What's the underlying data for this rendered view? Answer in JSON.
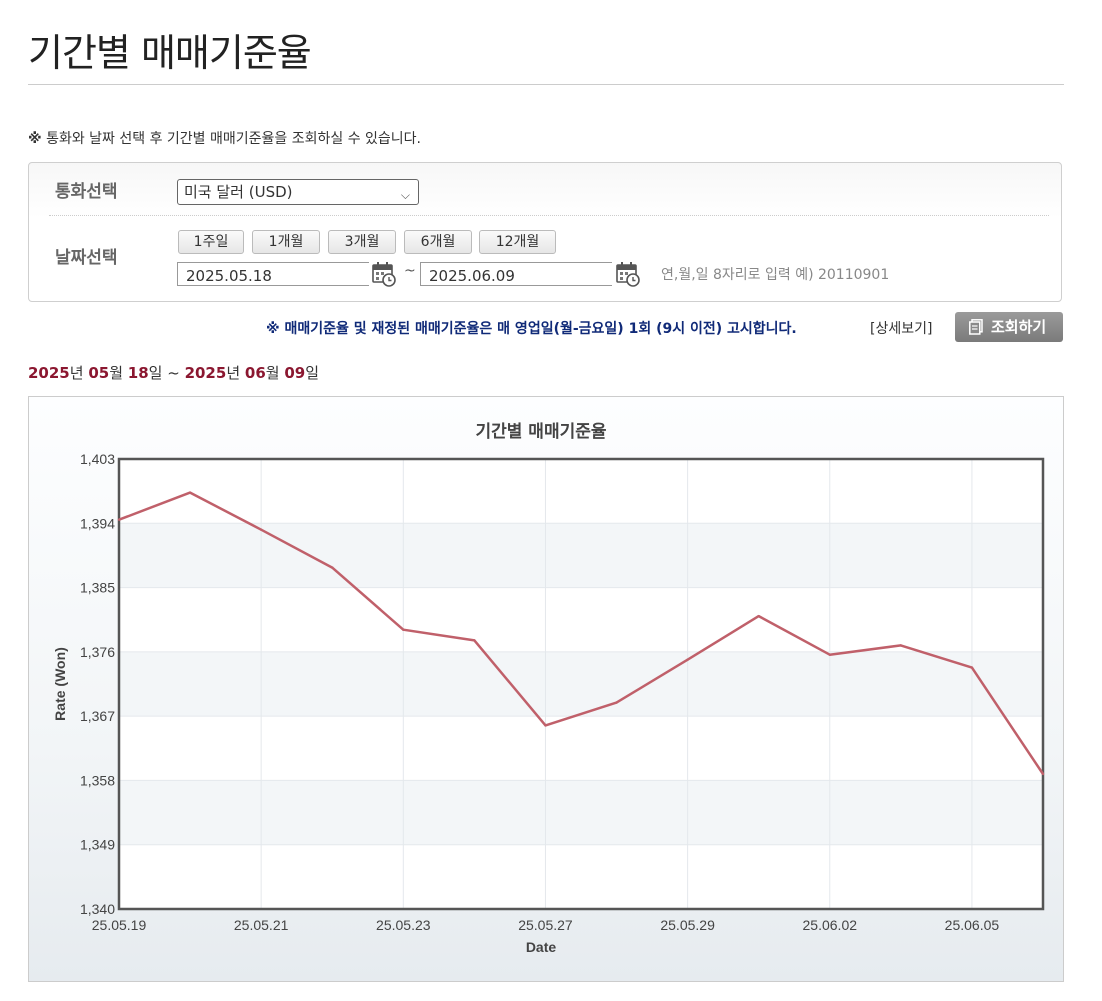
{
  "page": {
    "title": "기간별 매매기준율"
  },
  "notice": {
    "mark": "※",
    "text": "통화와 날짜 선택 후 기간별 매매기준율을 조회하실 수 있습니다."
  },
  "search": {
    "currency_label": "통화선택",
    "currency_value": "미국 달러 (USD)",
    "date_label": "날짜선택",
    "period_buttons": [
      "1주일",
      "1개월",
      "3개월",
      "6개월",
      "12개월"
    ],
    "start_date": "2025.05.18",
    "end_date": "2025.06.09",
    "separator": "~",
    "hint": "연,월,일 8자리로 입력 예) 20110901"
  },
  "announcement": "※ 매매기준율 및 재정된 매매기준율은 매 영업일(월-금요일) 1회 (9시 이전) 고시합니다.",
  "detail_link": "[상세보기]",
  "query_button": "조회하기",
  "range": {
    "y1": "2025",
    "y1s": "년 ",
    "m1": "05",
    "m1s": "월 ",
    "d1": "18",
    "d1s": "일 ~ ",
    "y2": "2025",
    "y2s": "년 ",
    "m2": "06",
    "m2s": "월 ",
    "d2": "09",
    "d2s": "일"
  },
  "colors": {
    "line": "#c0606a",
    "accent": "#8b1730",
    "announce": "#102a78"
  },
  "chart_data": {
    "type": "line",
    "title": "기간별 매매기준율",
    "xlabel": "Date",
    "ylabel": "Rate (Won)",
    "ylim": [
      1340,
      1403
    ],
    "yticks": [
      1340,
      1349,
      1358,
      1367,
      1376,
      1385,
      1394,
      1403
    ],
    "ytick_labels": [
      "1,340",
      "1,349",
      "1,358",
      "1,367",
      "1,376",
      "1,385",
      "1,394",
      "1,403"
    ],
    "xtick_labels": [
      "25.05.19",
      "25.05.21",
      "25.05.23",
      "25.05.27",
      "25.05.29",
      "25.06.02",
      "25.06.05"
    ],
    "x_dates": [
      "25.05.19",
      "25.05.20",
      "25.05.21",
      "25.05.22",
      "25.05.23",
      "25.05.26",
      "25.05.27",
      "25.05.28",
      "25.05.29",
      "25.05.30",
      "25.06.02",
      "25.06.04",
      "25.06.05",
      "25.06.09"
    ],
    "series": [
      {
        "values": [
          1394.5,
          1398.3,
          1393.1,
          1387.8,
          1379.1,
          1377.6,
          1365.7,
          1368.9,
          1374.9,
          1381.0,
          1375.6,
          1376.9,
          1373.8,
          1358.9
        ]
      }
    ],
    "grid": true
  }
}
